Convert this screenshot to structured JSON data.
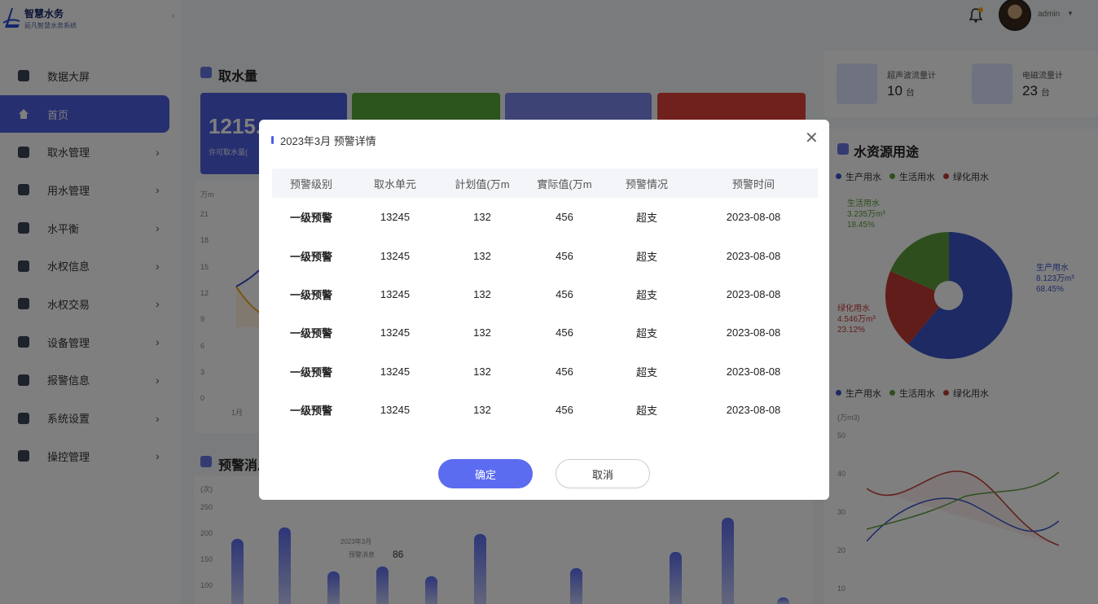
{
  "app": {
    "title": "智慧水务",
    "subtitle": "延凡智慧水务系统"
  },
  "header": {
    "username": "admin"
  },
  "sidebar": {
    "items": [
      {
        "label": "数据大屏",
        "active": false,
        "arrow": false
      },
      {
        "label": "首页",
        "active": true,
        "arrow": false
      },
      {
        "label": "取水管理",
        "active": false,
        "arrow": true
      },
      {
        "label": "用水管理",
        "active": false,
        "arrow": true
      },
      {
        "label": "水平衡",
        "active": false,
        "arrow": true
      },
      {
        "label": "水权信息",
        "active": false,
        "arrow": true
      },
      {
        "label": "水权交易",
        "active": false,
        "arrow": true
      },
      {
        "label": "设备管理",
        "active": false,
        "arrow": true
      },
      {
        "label": "报警信息",
        "active": false,
        "arrow": true
      },
      {
        "label": "系统设置",
        "active": false,
        "arrow": true
      },
      {
        "label": "操控管理",
        "active": false,
        "arrow": true
      }
    ]
  },
  "main": {
    "intake_title": "取水量",
    "stat_value": "1215.",
    "stat_sub": "许可取水量(",
    "chart_unit": "万m",
    "y_ticks": [
      "21",
      "18",
      "15",
      "12",
      "9",
      "6",
      "3",
      "0"
    ],
    "x_first": "1月",
    "warning_title": "预警消息",
    "bar_unit": "(次)",
    "bar_ticks": [
      "250",
      "200",
      "150",
      "100"
    ],
    "tooltip_date": "2023年3月",
    "tooltip_label": "预警消息",
    "tooltip_value": "86"
  },
  "devices": [
    {
      "name": "超声波流量计",
      "count": "10",
      "unit": "台"
    },
    {
      "name": "电磁流量计",
      "count": "23",
      "unit": "台"
    }
  ],
  "usage": {
    "title": "水资源用途",
    "legend": [
      {
        "label": "生产用水",
        "color": "#3b55c9"
      },
      {
        "label": "生活用水",
        "color": "#5c9e3a"
      },
      {
        "label": "绿化用水",
        "color": "#c23a35"
      }
    ],
    "pie_labels": {
      "life": {
        "name": "生活用水",
        "amount": "3.235万m³",
        "pct": "18.45%"
      },
      "prod": {
        "name": "生产用水",
        "amount": "8.123万m³",
        "pct": "68.45%"
      },
      "green": {
        "name": "绿化用水",
        "amount": "4.546万m³",
        "pct": "23.12%"
      }
    },
    "line_unit": "(万m3)",
    "line_ticks": [
      "50",
      "40",
      "30",
      "20",
      "10"
    ]
  },
  "modal": {
    "title": "2023年3月 预警详情",
    "columns": [
      "预警级别",
      "取水单元",
      "計划值(万m",
      "實际值(万m",
      "预警情况",
      "预警时间"
    ],
    "rows": [
      [
        "一级预警",
        "13245",
        "132",
        "456",
        "超支",
        "2023-08-08"
      ],
      [
        "一级预警",
        "13245",
        "132",
        "456",
        "超支",
        "2023-08-08"
      ],
      [
        "一级预警",
        "13245",
        "132",
        "456",
        "超支",
        "2023-08-08"
      ],
      [
        "一级预警",
        "13245",
        "132",
        "456",
        "超支",
        "2023-08-08"
      ],
      [
        "一级预警",
        "13245",
        "132",
        "456",
        "超支",
        "2023-08-08"
      ],
      [
        "一级预警",
        "13245",
        "132",
        "456",
        "超支",
        "2023-08-08"
      ]
    ],
    "confirm_label": "确定",
    "cancel_label": "取消"
  }
}
